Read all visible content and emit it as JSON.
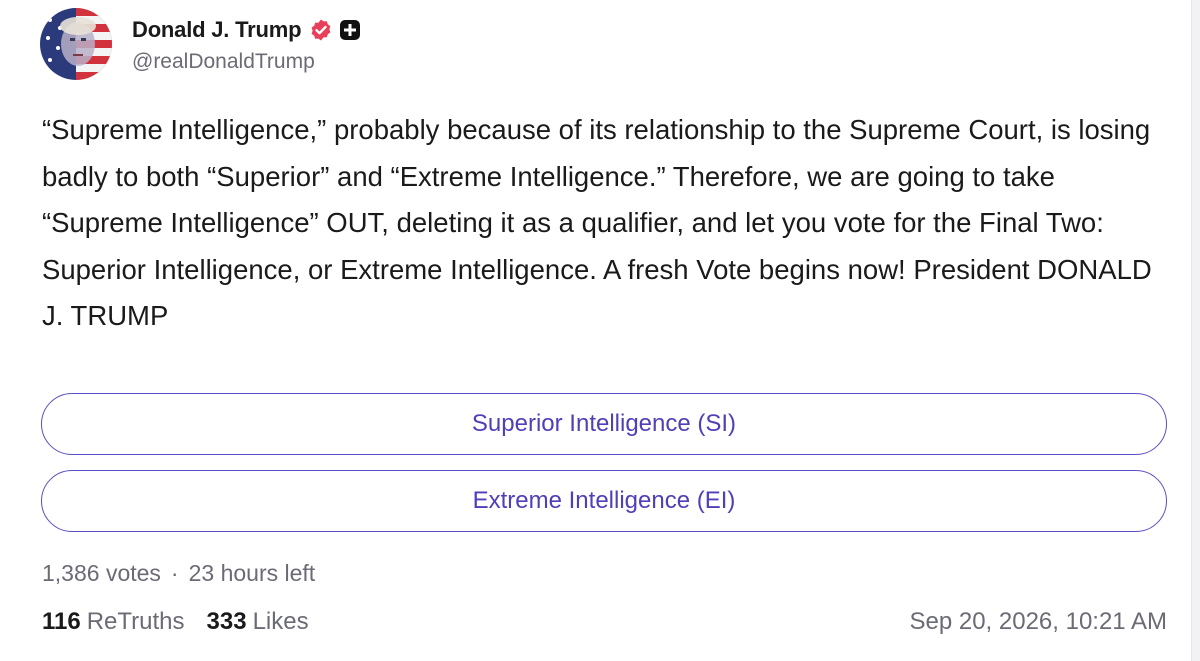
{
  "author": {
    "display_name": "Donald J. Trump",
    "handle": "@realDonaldTrump",
    "avatar_icon": "avatar-flag-portrait",
    "verified_icon": "verified-badge-icon",
    "verified_color": "#e8405a",
    "extra_icon": "plus-badge-icon"
  },
  "post": {
    "text": "“Supreme Intelligence,” probably because of its relationship to the Supreme Court, is losing badly to both “Superior” and “Extreme Intelligence.” Therefore, we are going to take “Supreme Intelligence” OUT, deleting it as a qualifier, and let you vote for the Final Two: Superior Intelligence, or Extreme Intelligence. A fresh Vote begins now! President DONALD J. TRUMP"
  },
  "poll": {
    "options": [
      {
        "label": "Superior Intelligence (SI)"
      },
      {
        "label": "Extreme Intelligence (EI)"
      }
    ],
    "votes_text": "1,386 votes",
    "separator": "·",
    "time_left": "23 hours left",
    "accent_color": "#5a4fc4"
  },
  "stats": {
    "retruths_count": "116",
    "retruths_label": "ReTruths",
    "likes_count": "333",
    "likes_label": "Likes"
  },
  "timestamp": "Sep 20, 2026, 10:21 AM"
}
